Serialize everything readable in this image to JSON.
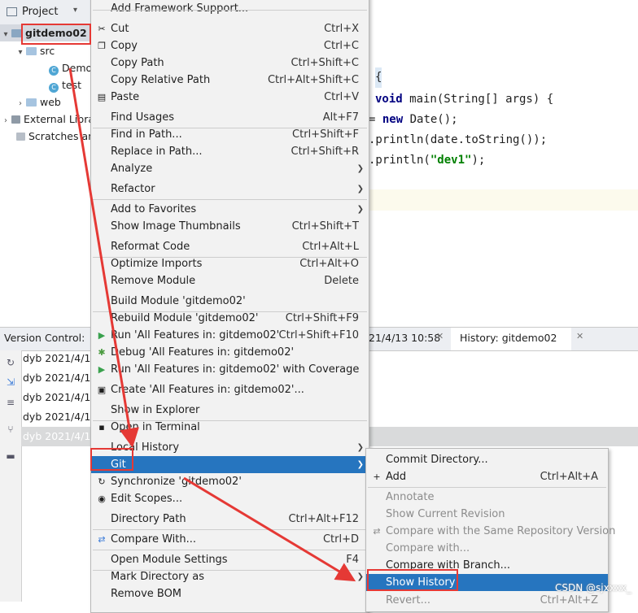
{
  "project": {
    "header": "Project",
    "tree": [
      "gitdemo02",
      "src",
      "Demo",
      "test",
      "web",
      "External Libra",
      "Scratches an"
    ]
  },
  "editor": {
    "lines": [
      {
        "pre": "",
        "kw": "",
        "rest": "{"
      },
      {
        "pre": "",
        "kw": "void",
        "rest": " main(String[] args) {"
      },
      {
        "pre": "= ",
        "kw": "new",
        "rest": " Date();"
      },
      {
        "pre": "",
        "kw": "",
        "rest": ".println(date.toString());"
      },
      {
        "pre": "",
        "kw": "",
        "rest": ".println(",
        "str": "\"dev1\"",
        "tail": ");"
      }
    ]
  },
  "version_control": {
    "label": "Version Control:",
    "tab1": "21/4/13 10:58",
    "tab2": "History: gitdemo02",
    "rows": [
      "dyb  2021/4/1",
      "dyb  2021/4/1",
      "dyb  2021/4/1",
      "dyb  2021/4/1",
      "dyb  2021/4/1"
    ]
  },
  "context_menu": {
    "items": [
      {
        "label": "Add Framework Support...",
        "shortcut": ""
      },
      {
        "label": "Cut",
        "shortcut": "Ctrl+X",
        "icon": "✂"
      },
      {
        "label": "Copy",
        "shortcut": "Ctrl+C",
        "icon": "❐"
      },
      {
        "label": "Copy Path",
        "shortcut": "Ctrl+Shift+C"
      },
      {
        "label": "Copy Relative Path",
        "shortcut": "Ctrl+Alt+Shift+C"
      },
      {
        "label": "Paste",
        "shortcut": "Ctrl+V",
        "icon": "▤"
      },
      {
        "label": "Find Usages",
        "shortcut": "Alt+F7"
      },
      {
        "label": "Find in Path...",
        "shortcut": "Ctrl+Shift+F"
      },
      {
        "label": "Replace in Path...",
        "shortcut": "Ctrl+Shift+R"
      },
      {
        "label": "Analyze",
        "shortcut": ""
      },
      {
        "label": "Refactor",
        "shortcut": ""
      },
      {
        "label": "Add to Favorites",
        "shortcut": ""
      },
      {
        "label": "Show Image Thumbnails",
        "shortcut": "Ctrl+Shift+T"
      },
      {
        "label": "Reformat Code",
        "shortcut": "Ctrl+Alt+L"
      },
      {
        "label": "Optimize Imports",
        "shortcut": "Ctrl+Alt+O"
      },
      {
        "label": "Remove Module",
        "shortcut": "Delete"
      },
      {
        "label": "Build Module 'gitdemo02'",
        "shortcut": ""
      },
      {
        "label": "Rebuild Module 'gitdemo02'",
        "shortcut": "Ctrl+Shift+F9"
      },
      {
        "label": "Run 'All Features in: gitdemo02'",
        "shortcut": "Ctrl+Shift+F10",
        "icon": "▶"
      },
      {
        "label": "Debug 'All Features in: gitdemo02'",
        "shortcut": "",
        "icon": "✱"
      },
      {
        "label": "Run 'All Features in: gitdemo02' with Coverage",
        "shortcut": "",
        "icon": "▶"
      },
      {
        "label": "Create 'All Features in: gitdemo02'...",
        "shortcut": "",
        "icon": "▣"
      },
      {
        "label": "Show in Explorer",
        "shortcut": ""
      },
      {
        "label": "Open in Terminal",
        "shortcut": "",
        "icon": "▪"
      },
      {
        "label": "Local History",
        "shortcut": ""
      },
      {
        "label": "Git",
        "shortcut": ""
      },
      {
        "label": "Synchronize 'gitdemo02'",
        "shortcut": "",
        "icon": "↻"
      },
      {
        "label": "Edit Scopes...",
        "shortcut": "",
        "icon": "◉"
      },
      {
        "label": "Directory Path",
        "shortcut": "Ctrl+Alt+F12"
      },
      {
        "label": "Compare With...",
        "shortcut": "Ctrl+D",
        "icon": "⇄"
      },
      {
        "label": "Open Module Settings",
        "shortcut": "F4"
      },
      {
        "label": "Mark Directory as",
        "shortcut": ""
      },
      {
        "label": "Remove BOM",
        "shortcut": ""
      }
    ]
  },
  "git_menu": {
    "items": [
      {
        "label": "Commit Directory...",
        "shortcut": ""
      },
      {
        "label": "Add",
        "shortcut": "Ctrl+Alt+A",
        "icon": "+"
      },
      {
        "label": "Annotate",
        "shortcut": ""
      },
      {
        "label": "Show Current Revision",
        "shortcut": ""
      },
      {
        "label": "Compare with the Same Repository Version",
        "shortcut": "",
        "icon": "⇄"
      },
      {
        "label": "Compare with...",
        "shortcut": ""
      },
      {
        "label": "Compare with Branch...",
        "shortcut": ""
      },
      {
        "label": "Show History",
        "shortcut": ""
      },
      {
        "label": "Revert...",
        "shortcut": "Ctrl+Alt+Z"
      }
    ]
  },
  "watermark": "CSDN @sjxxxx_",
  "colors": {
    "highlight": "#2675bf",
    "annotation": "#e53935"
  }
}
